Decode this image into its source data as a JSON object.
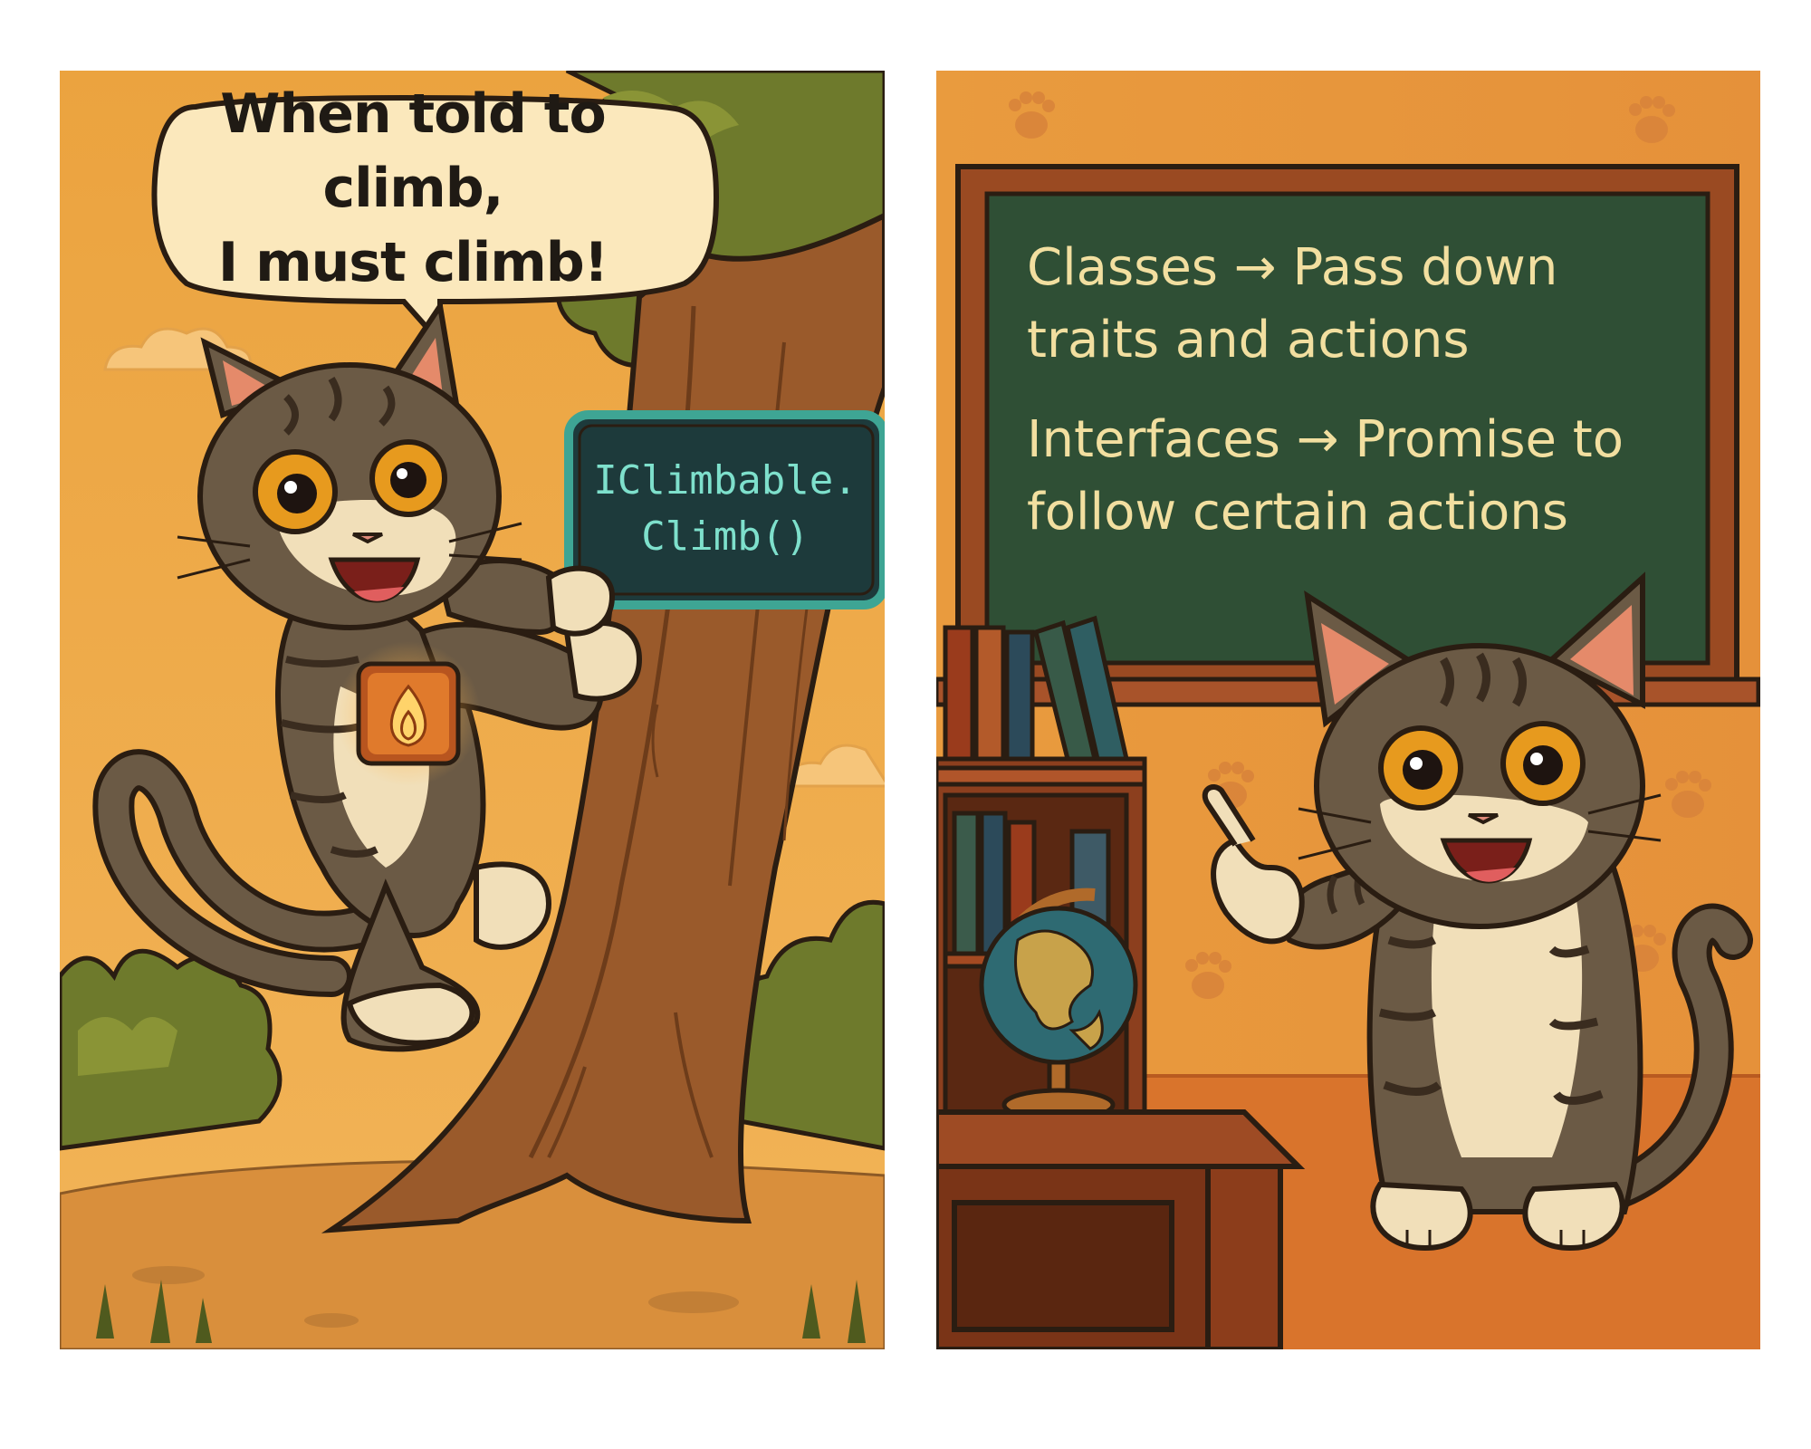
{
  "left_panel": {
    "speech_bubble": {
      "line1": "When told to climb,",
      "line2": "I must climb!"
    },
    "code_sign": {
      "line1": "IClimbable.",
      "line2": "Climb()"
    },
    "badge_icon": "flame-icon"
  },
  "right_panel": {
    "chalkboard": {
      "classes_line1": "Classes → Pass down",
      "classes_line2": "traits and actions",
      "interfaces_line1": "Interfaces → Promise to",
      "interfaces_line2": "follow certain actions"
    }
  },
  "colors": {
    "background_orange": "#efa94a",
    "chalkboard_green": "#2f4f35",
    "chalk_text": "#f2dfa0",
    "code_text": "#7ee0cc",
    "outline": "#2a1d12"
  }
}
